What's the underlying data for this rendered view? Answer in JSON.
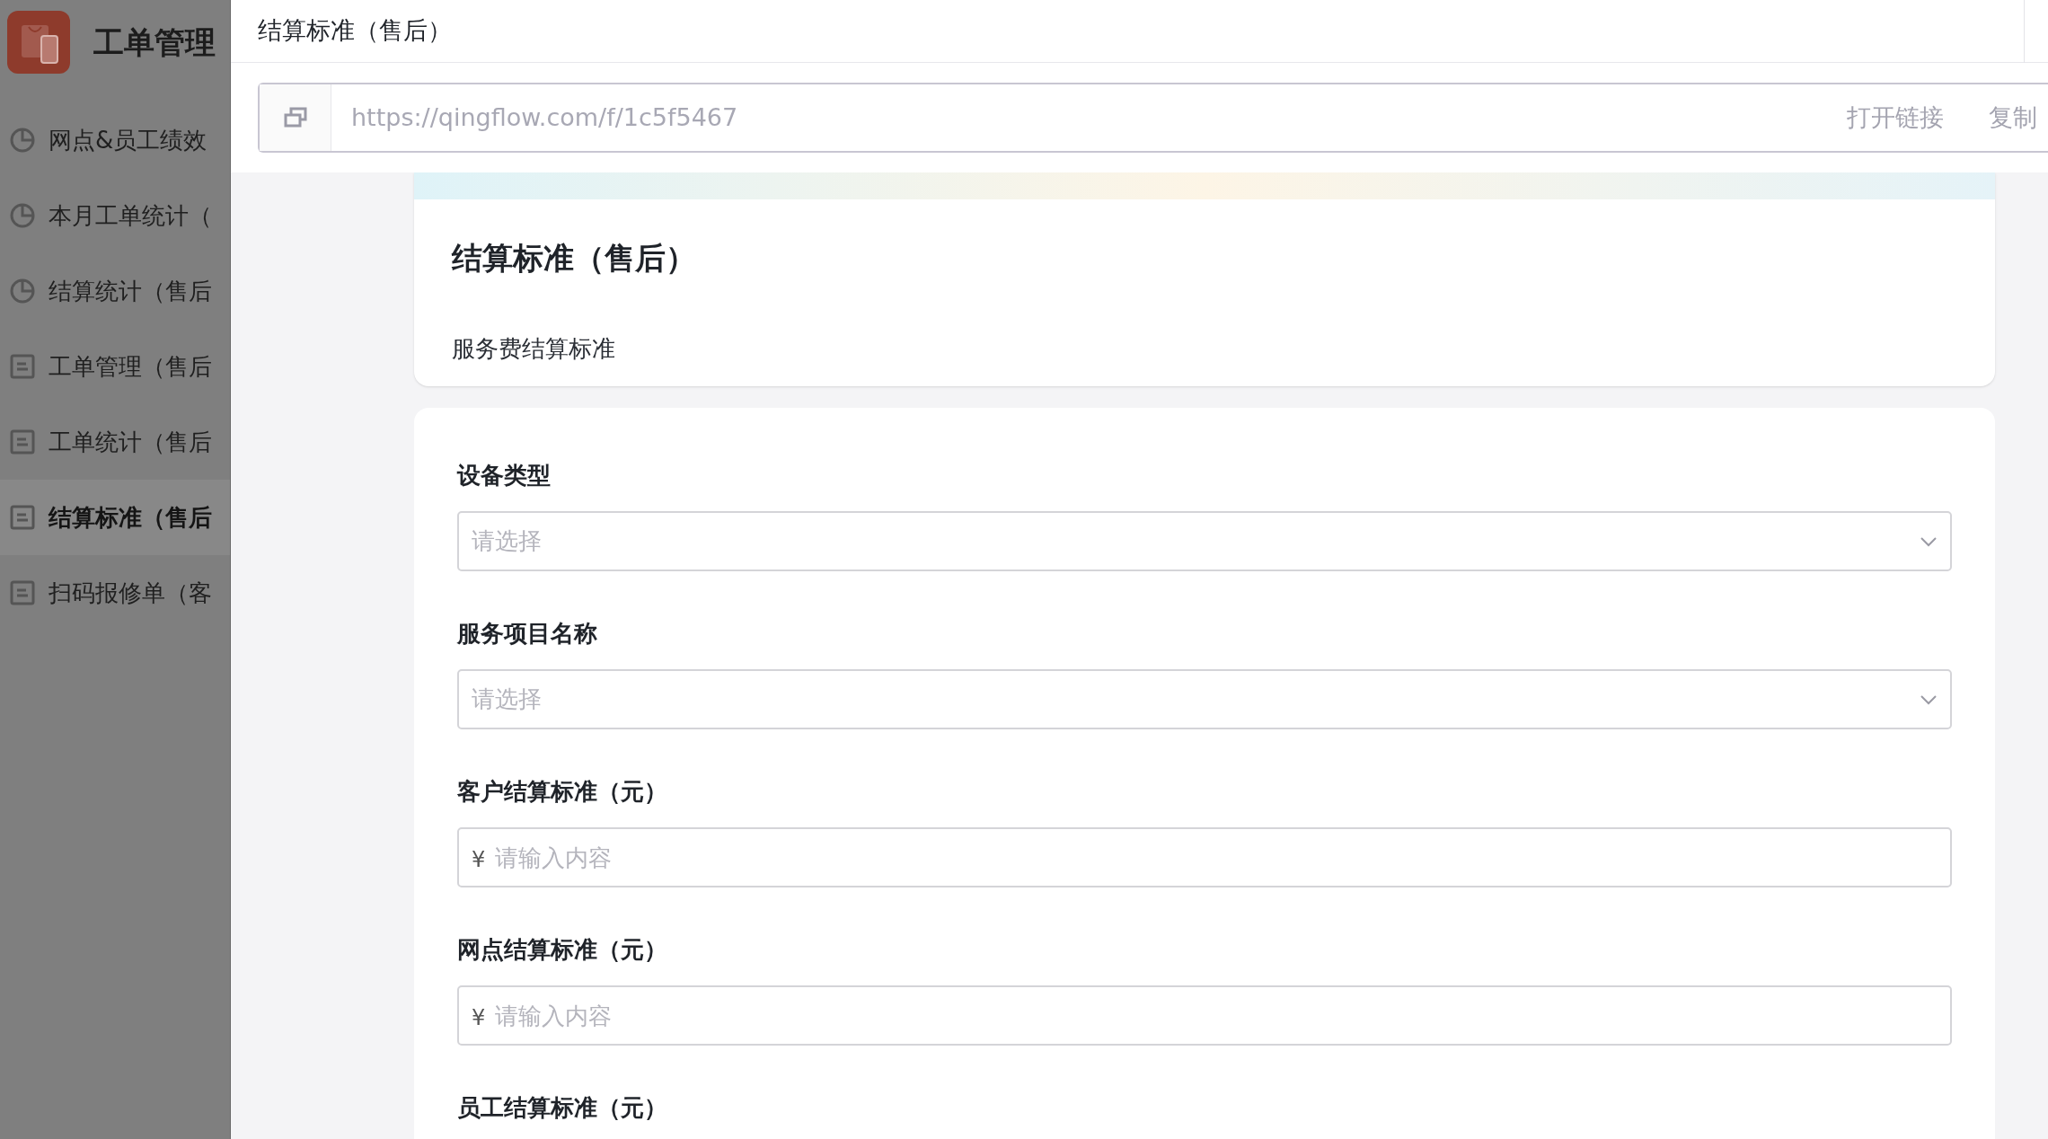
{
  "sidebar": {
    "app_title": "工单管理",
    "items": [
      {
        "kind": "chart",
        "label": "网点&员工绩效",
        "selected": false
      },
      {
        "kind": "chart",
        "label": "本月工单统计（",
        "selected": false
      },
      {
        "kind": "chart",
        "label": "结算统计（售后",
        "selected": false
      },
      {
        "kind": "form",
        "label": "工单管理（售后",
        "selected": false
      },
      {
        "kind": "form",
        "label": "工单统计（售后",
        "selected": false
      },
      {
        "kind": "form",
        "label": "结算标准（售后",
        "selected": true
      },
      {
        "kind": "form",
        "label": "扫码报修单（客",
        "selected": false
      }
    ]
  },
  "panel": {
    "title": "结算标准（售后）",
    "link": {
      "url": "https://qingflow.com/f/1c5f5467",
      "actions": [
        "打开链接",
        "复制"
      ]
    }
  },
  "form": {
    "title": "结算标准（售后）",
    "description": "服务费结算标准",
    "fields": [
      {
        "kind": "select",
        "label": "设备类型",
        "placeholder": "请选择"
      },
      {
        "kind": "select",
        "label": "服务项目名称",
        "placeholder": "请选择"
      },
      {
        "kind": "currency",
        "label": "客户结算标准（元）",
        "prefix": "¥",
        "placeholder": "请输入内容"
      },
      {
        "kind": "currency",
        "label": "网点结算标准（元）",
        "prefix": "¥",
        "placeholder": "请输入内容"
      },
      {
        "kind": "label",
        "label": "员工结算标准（元）"
      }
    ]
  }
}
